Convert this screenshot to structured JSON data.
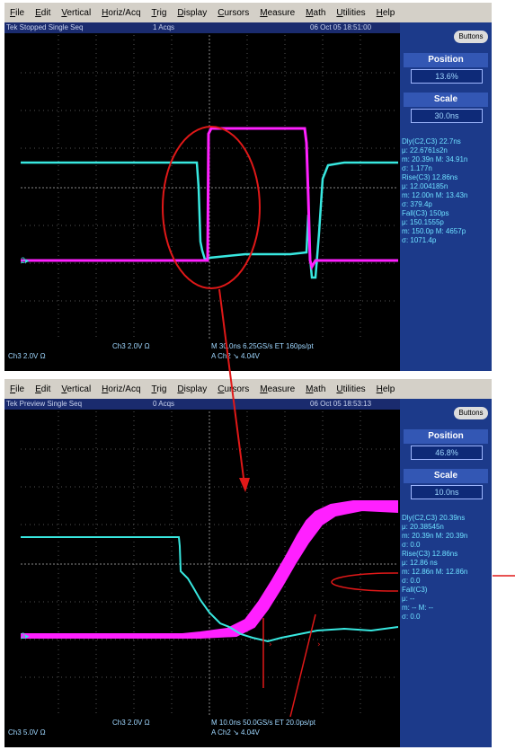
{
  "menu": [
    "File",
    "Edit",
    "Vertical",
    "Horiz/Acq",
    "Trig",
    "Display",
    "Cursors",
    "Measure",
    "Math",
    "Utilities",
    "Help"
  ],
  "scope1": {
    "status_left": "Tek  Stopped  Single Seq",
    "status_mid": "1 Acqs",
    "status_right": "06 Oct 05 18:51:00",
    "buttons_label": "Buttons",
    "position_title": "Position",
    "position_value": "13.6%",
    "scale_title": "Scale",
    "scale_value": "30.0ns",
    "meas": [
      "Dly(C2,C3)  22.7ns",
      "μ: 22.6761s2n",
      "m: 20.39n  M: 34.91n",
      "σ: 1.177n",
      "Rise(C3)  12.86ns",
      "μ: 12.004185n",
      "m: 12.00n  M: 13.43n",
      "σ: 379.4p",
      "Fall(C3)  150ps",
      "μ: 150.1555p",
      "m: 150.0p  M: 4657p",
      "σ: 1071.4p"
    ],
    "bottom_ch": "Ch3   2.0V   Ω",
    "bottom_mid": "M 30.0ns  6.25GS/s  ET 160ps/pt",
    "bottom_trig": "A Ch2 ↘ 4.04V",
    "bottom_left": "Ch3   2.0V   Ω"
  },
  "scope2": {
    "status_left": "Tek  Preview  Single Seq",
    "status_mid": "0 Acqs",
    "status_right": "06 Oct 05 18:53:13",
    "buttons_label": "Buttons",
    "position_title": "Position",
    "position_value": "46.8%",
    "scale_title": "Scale",
    "scale_value": "10.0ns",
    "meas": [
      "Dly(C2,C3)  20.39ns",
      "μ: 20.38545n",
      "m: 20.39n  M: 20.39n",
      "σ: 0.0",
      "Rise(C3)  12.86ns",
      "μ: 12.86 ns",
      "m: 12.86n  M: 12.86n",
      "σ: 0.0",
      "Fall(C3)",
      "μ: --",
      "m: --  M: --",
      "σ: 0.0"
    ],
    "bottom_ch": "Ch3   2.0V   Ω",
    "bottom_mid": "M 10.0ns  50.0GS/s  ET 20.0ps/pt",
    "bottom_trig": "A Ch2 ↘ 4.04V",
    "bottom_left": "Ch3   5.0V   Ω"
  },
  "colors": {
    "ch2": "#38e8e0",
    "ch3": "#ff20ff",
    "annotation": "#e01818",
    "panel": "#1c3a8a"
  }
}
